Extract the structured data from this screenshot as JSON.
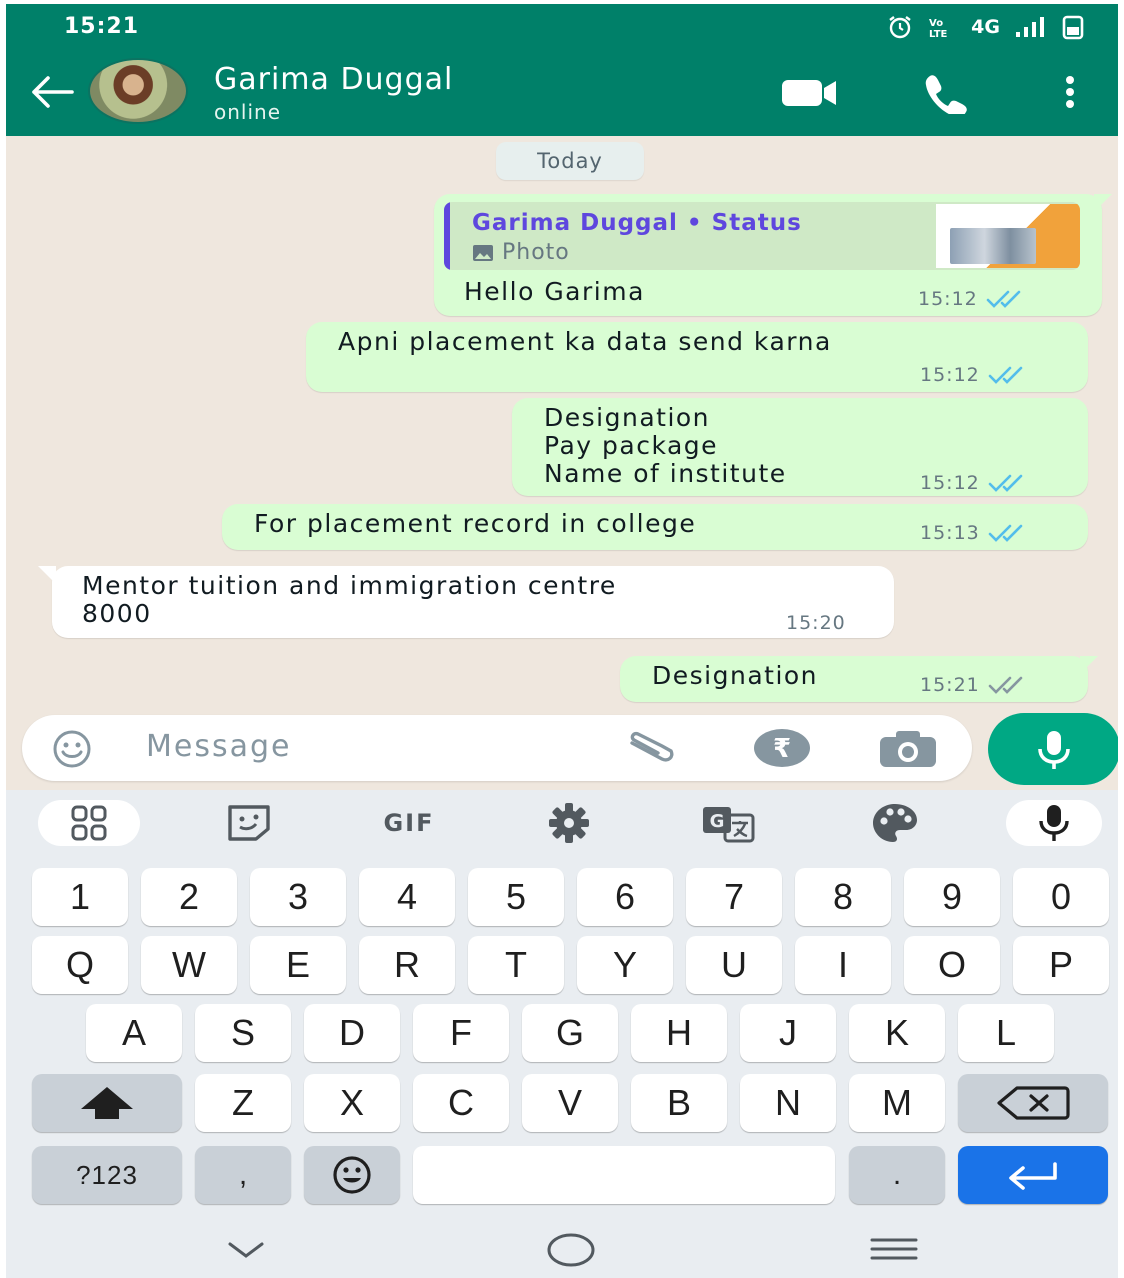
{
  "status_bar": {
    "time": "15:21",
    "network": "4G"
  },
  "header": {
    "contact_name": "Garima Duggal",
    "contact_status": "online"
  },
  "chat": {
    "date_label": "Today",
    "reply": {
      "title": "Garima Duggal • Status",
      "media_label": "Photo"
    },
    "messages": [
      {
        "text": "Hello Garima",
        "time": "15:12"
      },
      {
        "text": "Apni placement ka data send karna",
        "time": "15:12"
      },
      {
        "text": "Designation\nPay package\nName of institute",
        "time": "15:12"
      },
      {
        "text": "For placement record in college",
        "time": "15:13"
      },
      {
        "text": "Mentor tuition and immigration centre\n8000",
        "time": "15:20"
      },
      {
        "text": "Designation",
        "time": "15:21"
      }
    ]
  },
  "input": {
    "placeholder": "Message"
  },
  "keyboard": {
    "toolbar_gif": "GIF",
    "number_row": [
      "1",
      "2",
      "3",
      "4",
      "5",
      "6",
      "7",
      "8",
      "9",
      "0"
    ],
    "row1": [
      "Q",
      "W",
      "E",
      "R",
      "T",
      "Y",
      "U",
      "I",
      "O",
      "P"
    ],
    "row2": [
      "A",
      "S",
      "D",
      "F",
      "G",
      "H",
      "J",
      "K",
      "L"
    ],
    "row3": [
      "Z",
      "X",
      "C",
      "V",
      "B",
      "N",
      "M"
    ],
    "symbols_label": "?123",
    "comma": ",",
    "period": "."
  },
  "colors": {
    "header": "#008069",
    "outgoing": "#d9fdd3",
    "incoming": "#ffffff",
    "read_ticks": "#53bdeb",
    "accent": "#00a884",
    "enter_key": "#1a73e8"
  }
}
